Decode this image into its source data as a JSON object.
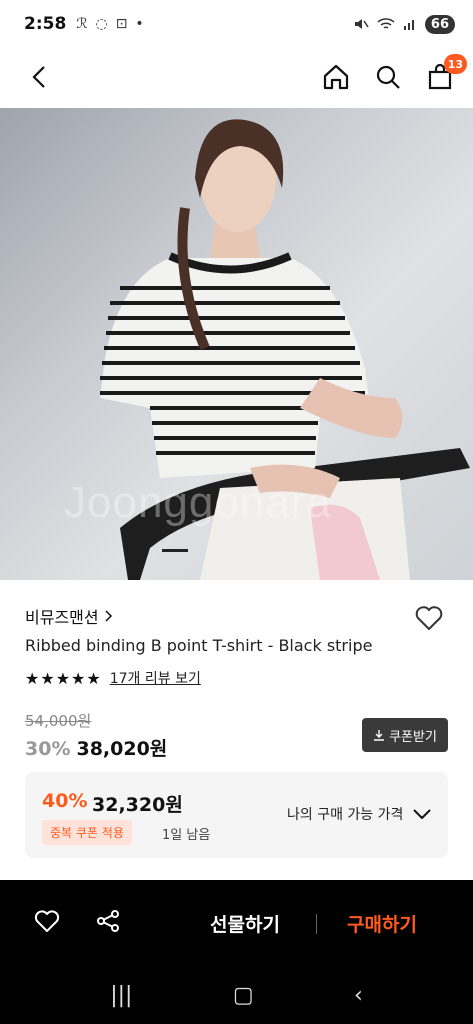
{
  "status_bar": {
    "time": "2:58",
    "battery": "66"
  },
  "nav": {
    "cart_count": "13"
  },
  "product": {
    "brand": "비뮤즈맨션",
    "name": "Ribbed binding B point T-shirt - Black stripe",
    "stars": "★★★★★",
    "review_link": "17개 리뷰 보기",
    "watermark": "Joonggonara",
    "original_price": "54,000원",
    "discount": "30%",
    "price": "38,020원",
    "coupon_button": "쿠폰받기"
  },
  "coupon_box": {
    "discount": "40%",
    "price": "32,320원",
    "tag": "중복 쿠폰 적용",
    "remaining": "1일 남음",
    "my_price_label": "나의 구매 가능 가격"
  },
  "bottom_bar": {
    "gift_label": "선물하기",
    "buy_label": "구매하기"
  },
  "colors": {
    "accent": "#ff5a1f"
  }
}
